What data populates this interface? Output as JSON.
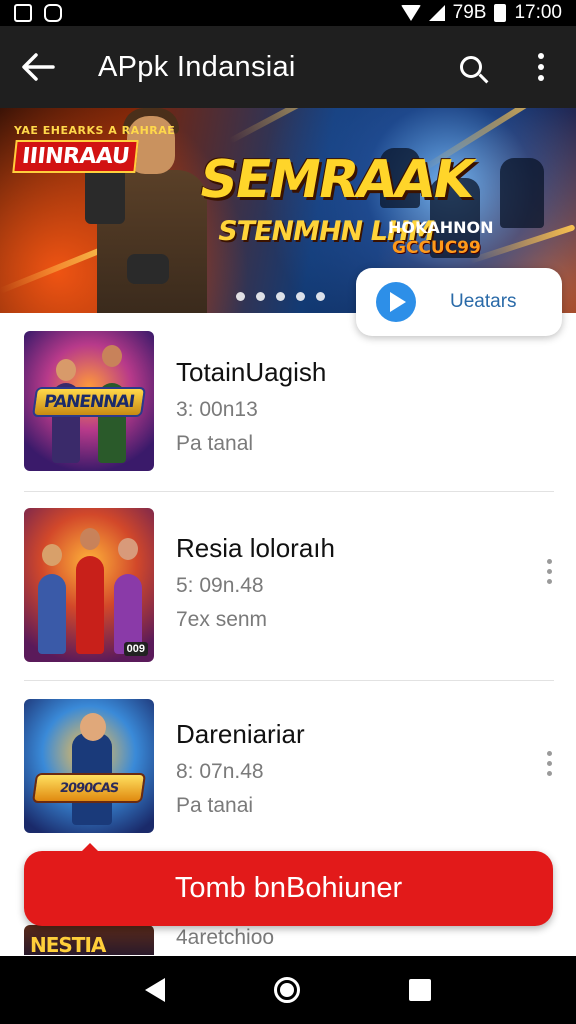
{
  "status_bar": {
    "left_icons": [
      "image-notification-icon",
      "app-notification-icon"
    ],
    "indicators": "79B",
    "time": "17:00"
  },
  "app_bar": {
    "title": "APpk Indansiai",
    "back_icon": "arrow-left-icon",
    "search_icon": "search-icon",
    "menu_icon": "more-vert-icon"
  },
  "banner": {
    "badge_small": "YAE EHEARKS A RAHRAE",
    "badge_big": "IIINRAAU",
    "title": "SEMRAAK",
    "subtitle": "STENMHN LHM",
    "tag_top": "HOKAHNON",
    "tag_bottom": "GCCUC99",
    "dots": 5
  },
  "update_card": {
    "label": "Ueatars",
    "icon": "play-circle-icon"
  },
  "apps": [
    {
      "name": "TotainUagish",
      "info": "3: 00n13",
      "category": "Pa tanal",
      "logo": "PANENNAI",
      "accent": "#b83a8a"
    },
    {
      "name": "Resia loloraıh",
      "info": "5: 09n.48",
      "category": "7ex senm",
      "corner": "009",
      "accent": "#d2482a"
    },
    {
      "name": "Dareniariar",
      "info": "8: 07n.48",
      "category": "Pa tanai",
      "logo": "2090CAS",
      "accent": "#3a8ad8"
    }
  ],
  "cta": {
    "label": "Tomb bnBohiuner"
  },
  "partial_item": {
    "logo": "NESTIA",
    "info": "4aretchioo"
  },
  "nav_bar": {
    "back": "nav-back-icon",
    "home": "nav-home-icon",
    "recents": "nav-recents-icon"
  }
}
